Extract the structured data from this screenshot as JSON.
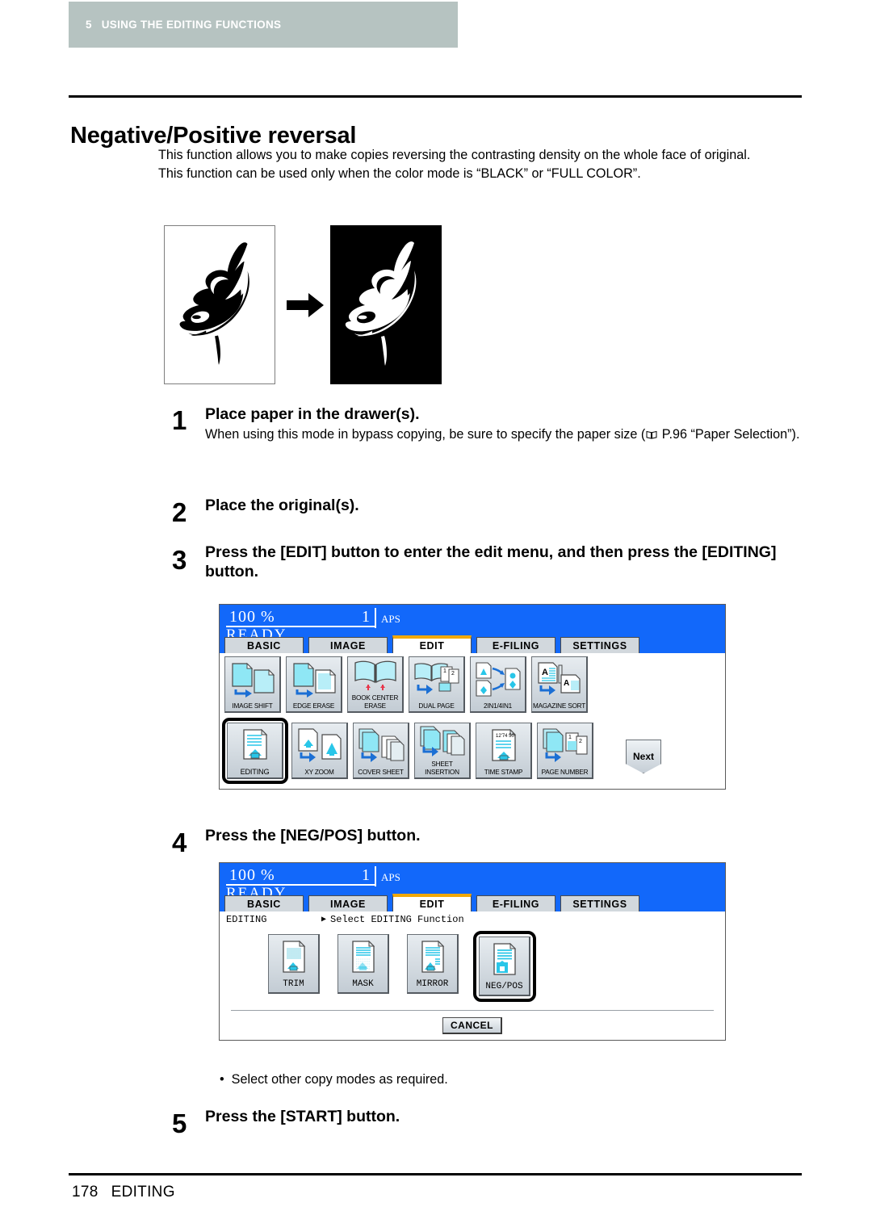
{
  "header": {
    "chapter_number": "5",
    "chapter_title": "USING THE EDITING FUNCTIONS"
  },
  "page_title": "Negative/Positive reversal",
  "intro": {
    "line1": "This function allows you to make copies reversing the contrasting density on the whole face of original.",
    "line2": "This function can be used only when the color mode is “BLACK” or “FULL COLOR”."
  },
  "figure": {
    "positive_label": "orca-positive-image",
    "negative_label": "orca-negative-image",
    "arrow_label": "right-arrow-icon"
  },
  "steps": [
    {
      "number": "1",
      "heading": "Place paper in the drawer(s).",
      "body_before": "When using this mode in bypass copying, be sure to specify the paper size (",
      "body_after": " P.96 “Paper Selection”)."
    },
    {
      "number": "2",
      "heading": "Place the original(s)."
    },
    {
      "number": "3",
      "heading": "Press the [EDIT] button to enter the edit menu, and then press the [EDITING] button."
    },
    {
      "number": "4",
      "heading": "Press the [NEG/POS] button."
    },
    {
      "number": "5",
      "heading": "Press the [START] button."
    }
  ],
  "bullet_note": {
    "dot": "•",
    "text": "Select other copy modes as required."
  },
  "lcd": {
    "ratio": "100 %",
    "copies": "1",
    "aps": "APS",
    "status": "READY",
    "tabs": [
      {
        "label": "BASIC",
        "active": false
      },
      {
        "label": "IMAGE",
        "active": false
      },
      {
        "label": "EDIT",
        "active": true
      },
      {
        "label": "E-FILING",
        "active": false
      },
      {
        "label": "SETTINGS",
        "active": false
      }
    ],
    "colors": {
      "screen_blue": "#1268fa",
      "active_tab_accent": "#f0a808",
      "icon_cyan": "#39d8f0",
      "chapter_band": "#b6c3c1"
    }
  },
  "edit_menu": {
    "row1": [
      {
        "label": "IMAGE SHIFT",
        "icon": "image-shift-icon",
        "selected": false
      },
      {
        "label": "EDGE ERASE",
        "icon": "edge-erase-icon",
        "selected": false
      },
      {
        "label": "BOOK CENTER ERASE",
        "icon": "book-center-erase-icon",
        "selected": false
      },
      {
        "label": "DUAL  PAGE",
        "icon": "dual-page-icon",
        "selected": false
      },
      {
        "label": "2IN1/4IN1",
        "icon": "2in1-4in1-icon",
        "selected": false
      },
      {
        "label": "MAGAZINE SORT",
        "icon": "magazine-sort-icon",
        "selected": false
      }
    ],
    "row2": [
      {
        "label": "EDITING",
        "icon": "editing-icon",
        "selected": true
      },
      {
        "label": "XY ZOOM",
        "icon": "xy-zoom-icon",
        "selected": false
      },
      {
        "label": "COVER SHEET",
        "icon": "cover-sheet-icon",
        "selected": false
      },
      {
        "label": "SHEET INSERTION",
        "icon": "sheet-insertion-icon",
        "selected": false
      },
      {
        "label": "TIME STAMP",
        "icon": "time-stamp-icon",
        "selected": false
      },
      {
        "label": "PAGE NUMBER",
        "icon": "page-number-icon",
        "selected": false
      }
    ],
    "next_label": "Next"
  },
  "editing_menu": {
    "crumb_label": "EDITING",
    "crumb_arrow": "▶",
    "crumb_text": "Select EDITING Function",
    "functions": [
      {
        "label": "TRIM",
        "icon": "trim-icon",
        "selected": false
      },
      {
        "label": "MASK",
        "icon": "mask-icon",
        "selected": false
      },
      {
        "label": "MIRROR",
        "icon": "mirror-icon",
        "selected": false
      },
      {
        "label": "NEG/POS",
        "icon": "neg-pos-icon",
        "selected": true
      }
    ],
    "cancel_label": "CANCEL"
  },
  "footer": {
    "page_number": "178",
    "section": "EDITING"
  }
}
